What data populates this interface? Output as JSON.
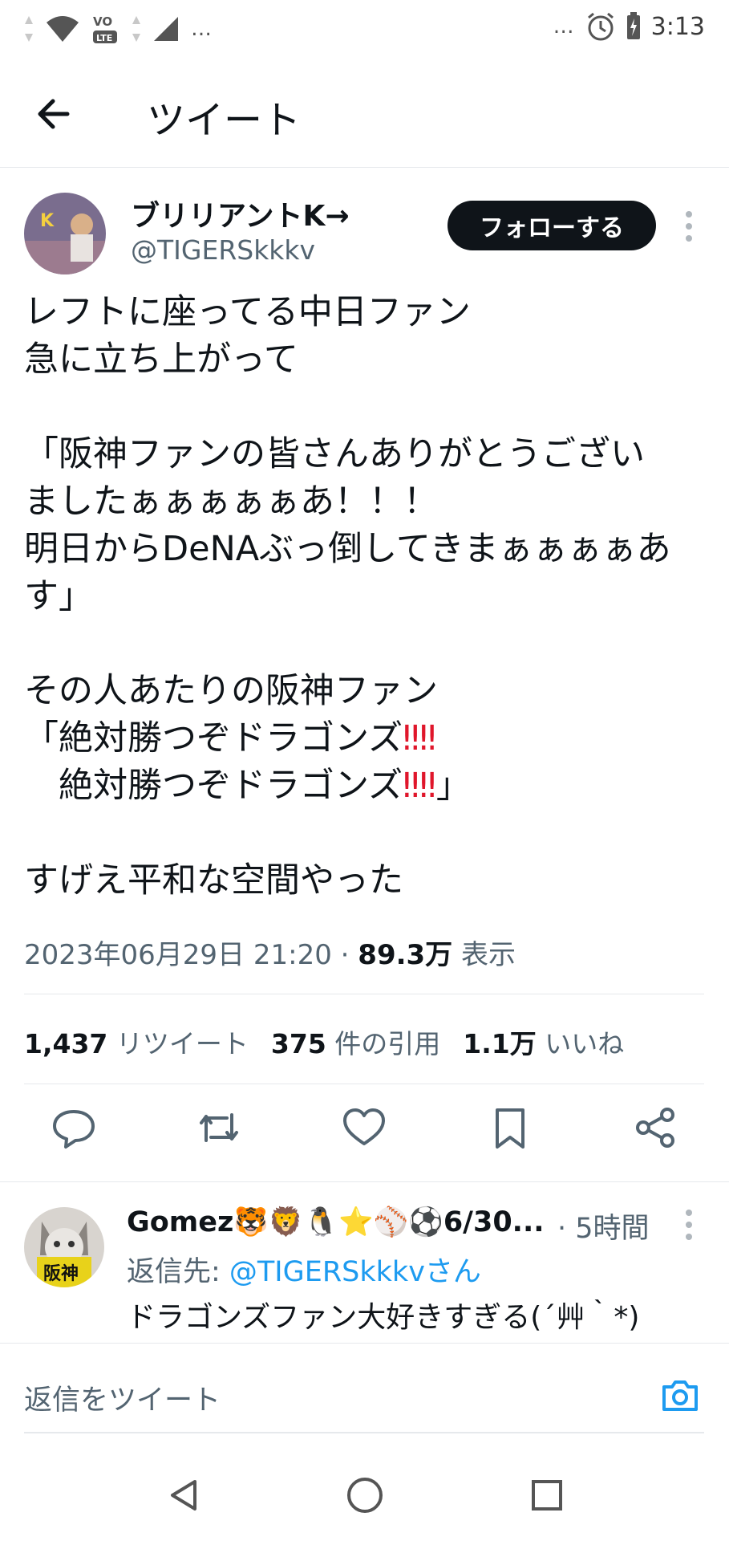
{
  "status_bar": {
    "time": "3:13",
    "lte_label": "LTE",
    "volte_label": "VO",
    "more_left": "…",
    "more_right": "…"
  },
  "header": {
    "title": "ツイート"
  },
  "tweet": {
    "author_name": "ブリリアントK→",
    "author_handle": "@TIGERSkkkv",
    "follow_label": "フォローする",
    "lines": [
      "レフトに座ってる中日ファン",
      "急に立ち上がって",
      "",
      "「阪神ファンの皆さんありがとうござい",
      "ましたぁぁぁぁぁあ！！！",
      "明日からDeNAぶっ倒してきまぁぁぁぁあ",
      "す」",
      "",
      "その人あたりの阪神ファン",
      "「絶対勝つぞドラゴンズ",
      "　絶対勝つぞドラゴンズ",
      "",
      "すげえ平和な空間やった"
    ],
    "emoji_double_exclamation": "‼",
    "closing_bracket": "」",
    "timestamp": "2023年06月29日 21:20",
    "separator": "·",
    "views_count": "89.3万",
    "views_label": "表示",
    "retweets_count": "1,437",
    "retweets_label": "リツイート",
    "quotes_count": "375",
    "quotes_label": "件の引用",
    "likes_count": "1.1万",
    "likes_label": "いいね"
  },
  "actions": [
    "reply-icon",
    "retweet-icon",
    "like-icon",
    "bookmark-icon",
    "share-icon"
  ],
  "reply": {
    "author_name": "Gomez🐯🦁🐧⭐⚾⚽6/30...",
    "time": "· 5時間",
    "reply_to_prefix": "返信先: ",
    "reply_to_handle": "@TIGERSkkkvさん",
    "text": "ドラゴンズファン大好きすぎる(´艸｀*)"
  },
  "composer": {
    "placeholder": "返信をツイート"
  },
  "colors": {
    "link": "#1d9bf0",
    "muted": "#536471",
    "text": "#0f1419",
    "alert": "#e0162b"
  }
}
